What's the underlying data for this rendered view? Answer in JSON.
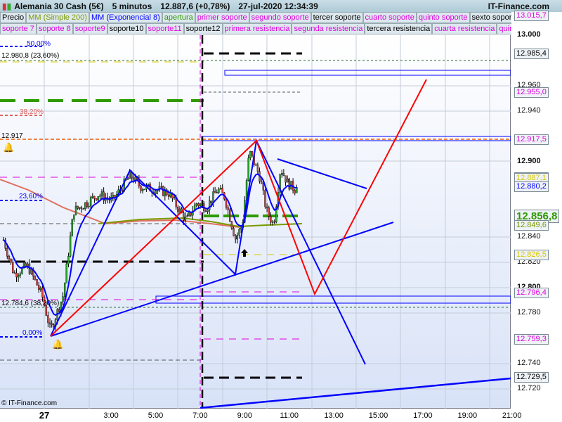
{
  "header": {
    "instrument": "Alemania 30 Cash (5€)",
    "timeframe": "5 minutos",
    "price": "12.887,6 (+0,78%)",
    "datetime": "27-jul-2020 12:34:39",
    "brand": "IT-Finance.com"
  },
  "legend_row1": [
    {
      "label": "Precio",
      "color": "#000000"
    },
    {
      "label": "MM (Simple 200)",
      "color": "#7a9a00"
    },
    {
      "label": "MM (Exponencial 8)",
      "color": "#0000ff"
    },
    {
      "label": "apertura",
      "color": "#2e9a00"
    },
    {
      "label": "primer soporte",
      "color": "#e000e0"
    },
    {
      "label": "segundo soporte",
      "color": "#e000e0"
    },
    {
      "label": "tercer soporte",
      "color": "#000000"
    },
    {
      "label": "cuarto soporte",
      "color": "#e000e0"
    },
    {
      "label": "quinto soporte",
      "color": "#e000e0"
    },
    {
      "label": "sexto soporte",
      "color": "#000000"
    }
  ],
  "legend_row2": [
    {
      "label": "soporte 7",
      "color": "#e000e0"
    },
    {
      "label": "soporte 8",
      "color": "#e000e0"
    },
    {
      "label": "soporte9",
      "color": "#e000e0"
    },
    {
      "label": "soporte10",
      "color": "#000000"
    },
    {
      "label": "soporte11",
      "color": "#e000e0"
    },
    {
      "label": "soporte12",
      "color": "#000000"
    },
    {
      "label": "primera resistencia",
      "color": "#e000e0"
    },
    {
      "label": "segunda resistencia",
      "color": "#e000e0"
    },
    {
      "label": "tercera resistencia",
      "color": "#000000"
    },
    {
      "label": "cuarta resistencia",
      "color": "#e000e0"
    },
    {
      "label": "quinta",
      "color": "#e000e0"
    }
  ],
  "chart_labels": {
    "fib50": "50,00%",
    "fib236_top": "12.980,8 (23,60%)",
    "fib382": "38,20%",
    "alert": "12.917",
    "fib236": "23,60%",
    "fib382_bottom": "12.784,6 (38,20%)",
    "fib0": "0,00%",
    "copyright": "© IT-Finance.com"
  },
  "price_ticks": [
    "13.000",
    "12.960",
    "12.940",
    "12.900",
    "12.840",
    "12.820",
    "12.800",
    "12.780",
    "12.740",
    "12.720"
  ],
  "price_labels": [
    {
      "value": "13.015,7",
      "color": "#e000e0"
    },
    {
      "value": "12.985,4",
      "color": "#000000"
    },
    {
      "value": "12.955,0",
      "color": "#e000e0"
    },
    {
      "value": "12.917,5",
      "color": "#e000e0"
    },
    {
      "value": "12.887,6",
      "color": "#000000",
      "bg": "#f5c000"
    },
    {
      "value": "12.887,1",
      "color": "#d8c800"
    },
    {
      "value": "12.880,2",
      "color": "#0000ff"
    },
    {
      "value": "12.856,8",
      "color": "#2e9a00"
    },
    {
      "value": "12.849,6",
      "color": "#7a9a00"
    },
    {
      "value": "12.826,5",
      "color": "#d8c800"
    },
    {
      "value": "12.796,4",
      "color": "#e000e0"
    },
    {
      "value": "12.759,3",
      "color": "#e000e0"
    },
    {
      "value": "12.729,5",
      "color": "#000000"
    }
  ],
  "time_ticks": [
    "27",
    "3:00",
    "5:00",
    "7:00",
    "9:00",
    "11:00",
    "13:00",
    "15:00",
    "17:00",
    "19:00",
    "21:00"
  ],
  "price_series": {
    "hours": [
      -1.83,
      -1.36,
      -0.73,
      -0.1,
      0.28,
      0.85,
      1.32,
      1.8,
      2.43,
      3.07,
      3.86,
      4.33,
      4.96,
      5.59,
      6.07,
      6.38,
      6.83,
      7.3,
      7.79,
      8.1,
      8.58,
      8.9,
      9.21,
      9.66,
      9.98,
      10.3,
      10.61,
      10.93,
      11.25,
      11.41
    ],
    "prices": [
      12838,
      12811,
      12817,
      12794,
      12766,
      12794,
      12861,
      12866,
      12874,
      12869,
      12889,
      12880,
      12878,
      12875,
      12861,
      12853,
      12867,
      12864,
      12878,
      12872,
      12839,
      12850,
      12908,
      12889,
      12861,
      12850,
      12895,
      12883,
      12878,
      12887
    ]
  }
}
